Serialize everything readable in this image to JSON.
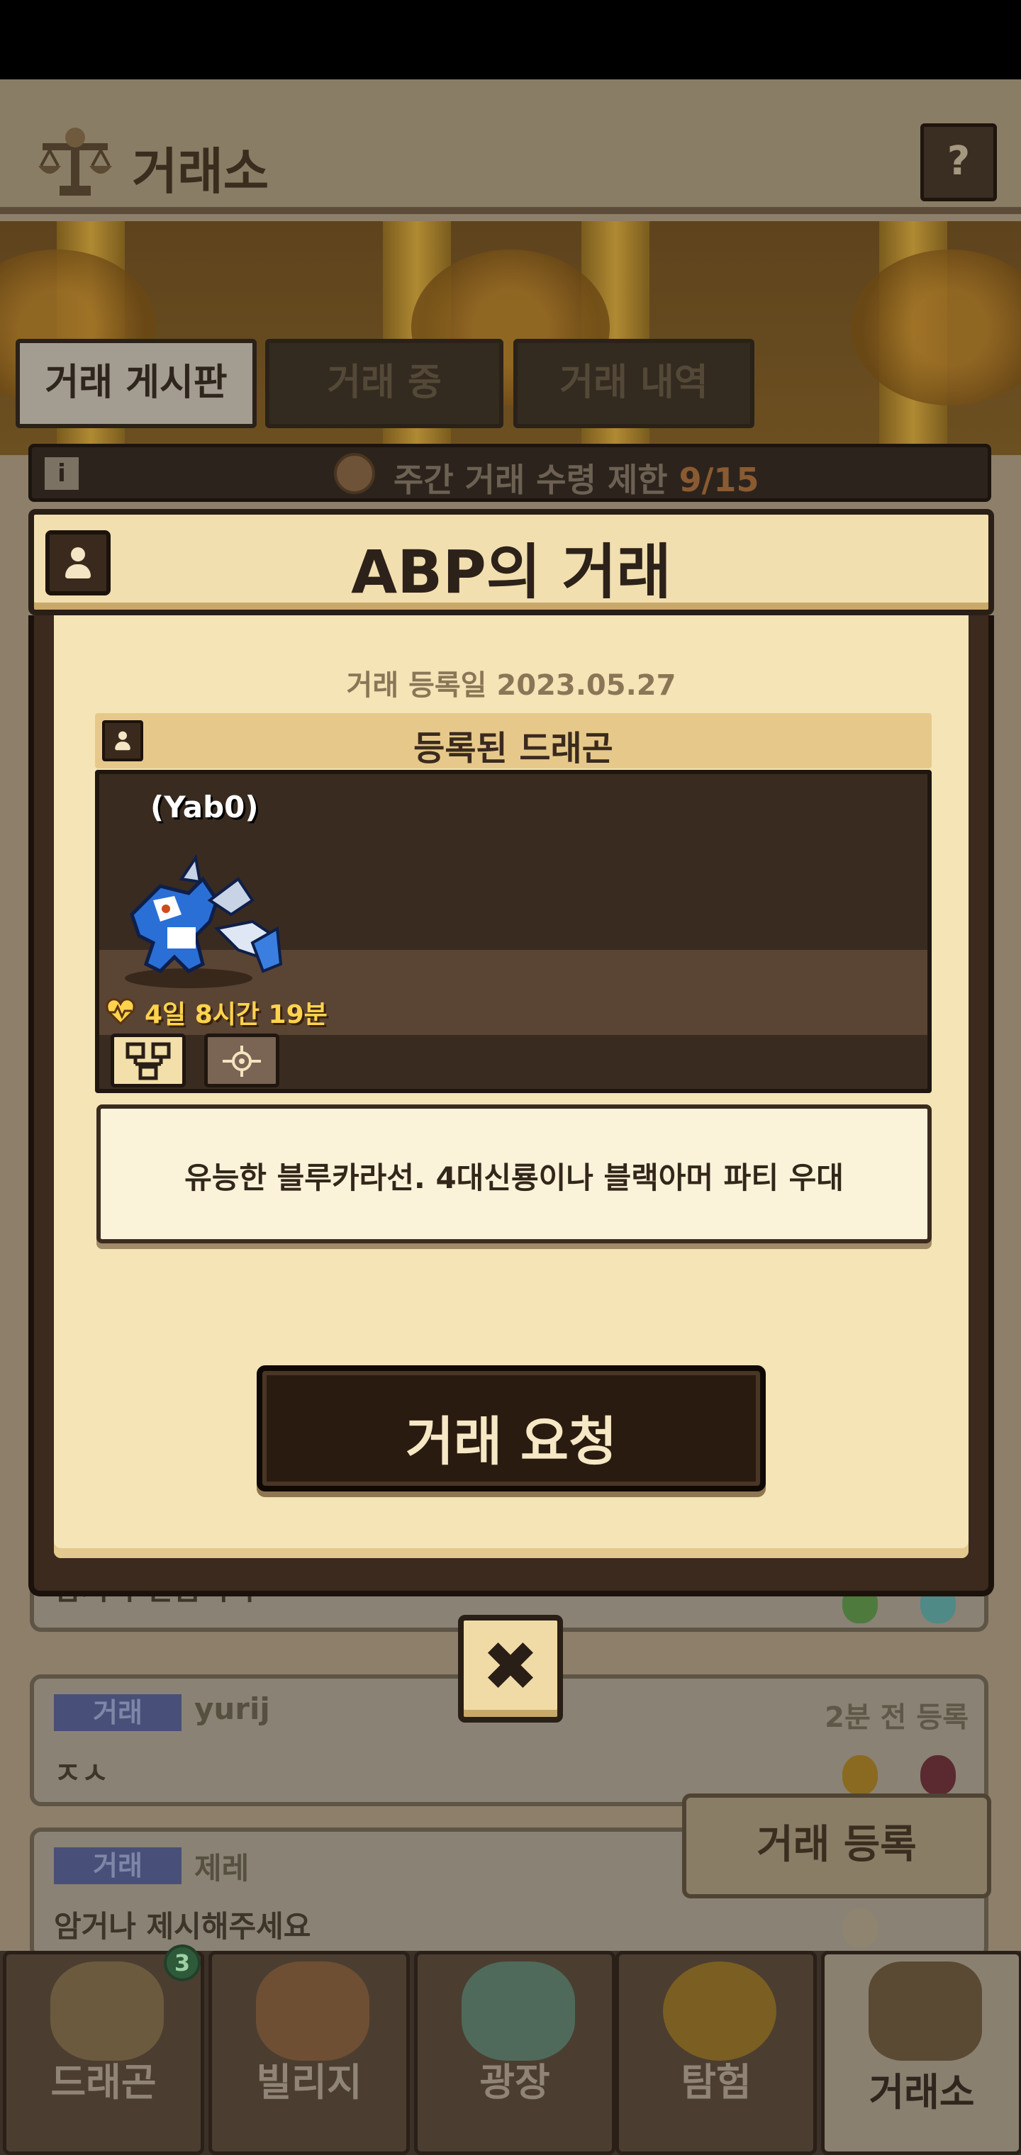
{
  "header": {
    "title": "거래소",
    "help_label": "?"
  },
  "tabs": [
    {
      "label": "거래 게시판",
      "active": true
    },
    {
      "label": "거래 중",
      "active": false
    },
    {
      "label": "거래 내역",
      "active": false
    }
  ],
  "weekly_limit": {
    "info_label": "i",
    "text": "주간 거래 수령 제한",
    "count": "9/15"
  },
  "trade_cards": [
    {
      "tag": "",
      "user": "",
      "time": "",
      "message": "암거나 받습니다"
    },
    {
      "tag": "거래",
      "user": "yurij",
      "time": "2분 전 등록",
      "message": "ㅈㅅ"
    },
    {
      "tag": "거래",
      "user": "제레",
      "time": "",
      "message": "암거나 제시해주세요"
    }
  ],
  "register_button": {
    "label": "거래 등록"
  },
  "bottom_nav": [
    {
      "label": "드래곤",
      "badge": "3"
    },
    {
      "label": "빌리지"
    },
    {
      "label": "광장"
    },
    {
      "label": "탐험"
    },
    {
      "label": "거래소",
      "active": true
    }
  ],
  "modal": {
    "title": "ABP의 거래",
    "registered_date": "거래 등록일 2023.05.27",
    "dragon_section_title": "등록된 드래곤",
    "dragon": {
      "name": "(Yab0)",
      "lifetime": "4일 8시간 19분"
    },
    "memo": "유능한 블루카라선. 4대신룡이나 블랙아머 파티 우대",
    "request_button": "거래 요청",
    "close_label": "✖"
  },
  "colors": {
    "paper": "#f4e4b6",
    "frame": "#3b2a1d",
    "accent_gold": "#ffd34d",
    "weekly_count": "#8a5a32"
  }
}
